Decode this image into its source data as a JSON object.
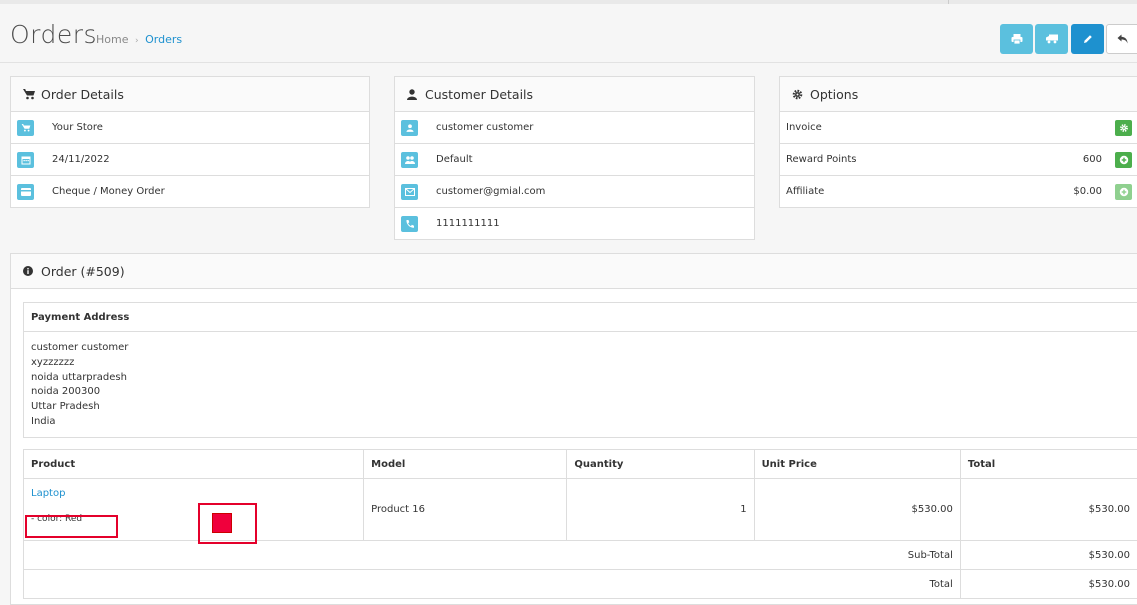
{
  "header": {
    "title": "Orders",
    "breadcrumb": {
      "home": "Home",
      "separator": "›",
      "current": "Orders"
    },
    "buttons": [
      "print-icon",
      "truck-icon",
      "pencil-icon",
      "reply-icon"
    ]
  },
  "order_details": {
    "title": "Order Details",
    "store": "Your Store",
    "date": "24/11/2022",
    "payment_method": "Cheque / Money Order"
  },
  "customer_details": {
    "title": "Customer Details",
    "name": "customer customer",
    "group": "Default",
    "email": "customer@gmial.com",
    "phone": "1111111111"
  },
  "options": {
    "title": "Options",
    "invoice_label": "Invoice",
    "reward_label": "Reward Points",
    "reward_value": "600",
    "affiliate_label": "Affiliate",
    "affiliate_value": "$0.00"
  },
  "order": {
    "title": "Order (#509)",
    "payment_address_label": "Payment Address",
    "address_lines": [
      "customer customer",
      "xyzzzzzz",
      "noida uttarpradesh",
      "noida 200300",
      "Uttar Pradesh",
      "India"
    ],
    "columns": [
      "Product",
      "Model",
      "Quantity",
      "Unit Price",
      "Total"
    ],
    "product": {
      "name": "Laptop",
      "option": "- color: Red",
      "model": "Product 16",
      "quantity": "1",
      "unit_price": "$530.00",
      "total": "$530.00"
    },
    "subtotal_label": "Sub-Total",
    "subtotal_value": "$530.00",
    "total_label": "Total",
    "total_value": "$530.00"
  },
  "colors": {
    "primary": "#1e91cf",
    "info": "#5bc0de",
    "success": "#4cae4c",
    "annotation": "#e4002b",
    "swatch": "#f0003c"
  }
}
